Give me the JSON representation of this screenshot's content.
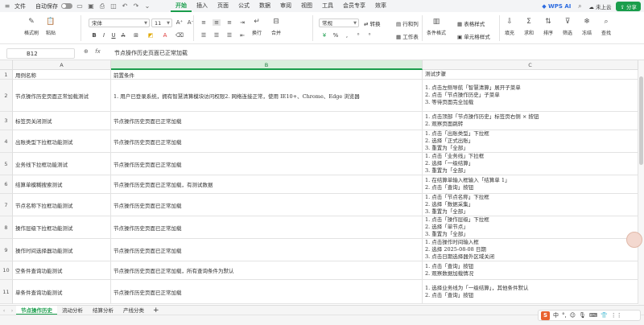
{
  "menubar": {
    "file": "文件",
    "autosave": "自动保存",
    "menus": [
      "开始",
      "插入",
      "页面",
      "公式",
      "数据",
      "审阅",
      "视图",
      "工具",
      "会员专享",
      "效率"
    ],
    "active_menu": "开始",
    "wps_ai": "WPS AI",
    "cloud": "未上云",
    "share": "分享"
  },
  "ribbon": {
    "format_painter": "格式刷",
    "paste": "粘贴",
    "font_name": "宋体",
    "font_size": "11",
    "number_format": "常规",
    "convert": "转换",
    "wrap": "换行",
    "merge": "合并",
    "row_col": "行和列",
    "worksheet": "工作表",
    "cond_format": "条件格式",
    "table_style": "表格样式",
    "cell_style": "单元格样式",
    "fill": "填充",
    "sum": "求和",
    "sort": "排序",
    "filter": "筛选",
    "freeze": "冻结",
    "find": "查找"
  },
  "formula_bar": {
    "cell_ref": "B12",
    "fx": "fx",
    "content": "节点操作历史页面已正常加载"
  },
  "grid": {
    "columns": [
      "A",
      "B",
      "C"
    ],
    "rows": [
      {
        "num": "1",
        "a": "用例名称",
        "b": "前置条件",
        "c": [
          "测试步骤"
        ]
      },
      {
        "num": "2",
        "a": "节点操作历史页面正常加载测试",
        "b": "1. 用户已登录系统，拥有智慧清算模块访问权限2. 网络连接正常，使用 IE10+、Chrome、Edge 浏览器",
        "c": [
          "1. 点击左侧导航「智慧清算」展开子菜单",
          "2. 点击「节点操作历史」子菜单",
          "3. 等待页面完全加载"
        ]
      },
      {
        "num": "3",
        "a": "标签页关闭测试",
        "b": "节点操作历史页面已正常加载",
        "c": [
          "1. 点击顶部「节点操作历史」标签页右侧 × 按钮",
          "2. 观察页面跳转"
        ]
      },
      {
        "num": "4",
        "a": "出账类型下拉框功能测试",
        "b": "节点操作历史页面已正常加载",
        "c": [
          "1. 点击「出账类型」下拉框",
          "2. 选择「正式出账」",
          "3. 重置为「全部」"
        ]
      },
      {
        "num": "5",
        "a": "业务线下拉框功能测试",
        "b": "节点操作历史页面已正常加载",
        "c": [
          "1. 点击「业务线」下拉框",
          "2. 选择「一级结算」",
          "3. 重置为「全部」"
        ]
      },
      {
        "num": "6",
        "a": "结算单模糊搜索测试",
        "b": "节点操作历史页面已正常加载，有测试数据",
        "c": [
          "1. 在结算单输入框输入「结算单 1」",
          "2. 点击「查询」按钮"
        ]
      },
      {
        "num": "7",
        "a": "节点名称下拉框功能测试",
        "b": "节点操作历史页面已正常加载",
        "c": [
          "1. 点击「节点名称」下拉框",
          "2. 选择「数据采集」",
          "3. 重置为「全部」"
        ]
      },
      {
        "num": "8",
        "a": "操作层级下拉框功能测试",
        "b": "节点操作历史页面已正常加载",
        "c": [
          "1. 点击「操作层级」下拉框",
          "2. 选择「单节点」",
          "3. 重置为「全部」"
        ]
      },
      {
        "num": "9",
        "a": "操作时间选择器功能测试",
        "b": "节点操作历史页面已正常加载",
        "c": [
          "1. 点击操作时间输入框",
          "2. 选择 2025-08-08 日期",
          "3. 点击日期选择器外区域关闭"
        ]
      },
      {
        "num": "10",
        "a": "空条件查询功能测试",
        "b": "节点操作历史页面已正常加载，所有查询条件为默认",
        "c": [
          "1. 点击「查询」按钮",
          "2. 观察数据加载情况"
        ]
      },
      {
        "num": "11",
        "a": "单条件查询功能测试",
        "b": "节点操作历史页面已正常加载",
        "c": [
          "1. 选择业务线为「一级结算」，其他条件默认",
          "2. 点击「查询」按钮"
        ]
      }
    ]
  },
  "sheets": [
    "节点操作历史",
    "流动分析",
    "结算分析",
    "产线分类"
  ],
  "active_sheet": "节点操作历史",
  "ime": {
    "logo": "S",
    "lang": "中"
  }
}
